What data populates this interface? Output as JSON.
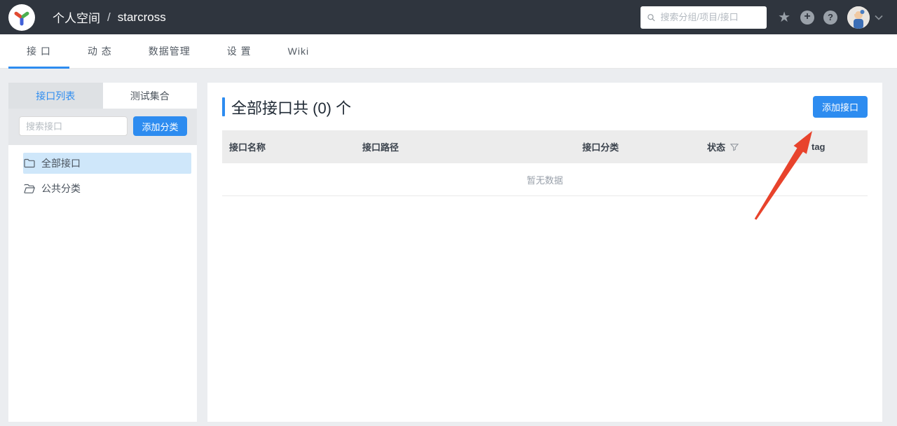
{
  "header": {
    "logo_icon": "yapi-logo",
    "breadcrumb": {
      "group": "个人空间",
      "separator": "/",
      "project": "starcross"
    },
    "search": {
      "placeholder": "搜索分组/项目/接口"
    },
    "icons": [
      "star-icon",
      "plus-circle-icon",
      "question-circle-icon",
      "avatar",
      "chevron-down-icon"
    ]
  },
  "nav": {
    "tabs": [
      "接 口",
      "动 态",
      "数据管理",
      "设 置",
      "Wiki"
    ],
    "active_tab": "接 口"
  },
  "sidebar": {
    "tabs": [
      "接口列表",
      "测试集合"
    ],
    "active_tab": "接口列表",
    "search": {
      "placeholder": "搜索接口"
    },
    "add_category_button": "添加分类",
    "tree": [
      {
        "label": "全部接口",
        "icon": "folder-icon",
        "selected": true
      },
      {
        "label": "公共分类",
        "icon": "folder-open-icon",
        "selected": false
      }
    ]
  },
  "main": {
    "title": "全部接口共 (0) 个",
    "interface_count": 0,
    "add_interface_button": "添加接口",
    "table": {
      "columns": [
        "接口名称",
        "接口路径",
        "接口分类",
        "状态",
        "tag"
      ],
      "filterable_column": "状态",
      "rows": [],
      "empty_text": "暂无数据"
    }
  },
  "annotation": {
    "type": "red-arrow",
    "points_to": "添加接口",
    "color": "#e8432c"
  },
  "colors": {
    "accent_blue": "#2d8cf0",
    "header_bg": "#2f353e",
    "page_bg": "#ebedf0",
    "selected_tree_bg": "#cfe7fa",
    "table_header_bg": "#ececec"
  }
}
